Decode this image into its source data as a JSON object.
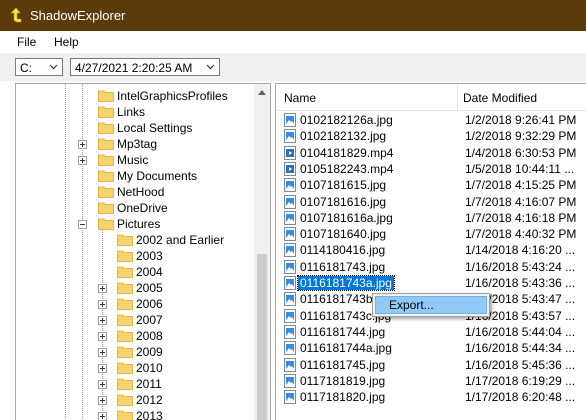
{
  "window": {
    "title": "ShadowExplorer"
  },
  "menu": {
    "items": [
      "File",
      "Help"
    ]
  },
  "toolbar": {
    "drive": "C:",
    "snapshot": "4/27/2021 2:20:25 AM"
  },
  "tree": {
    "items": [
      {
        "label": "IntelGraphicsProfiles",
        "expander": false
      },
      {
        "label": "Links",
        "expander": false
      },
      {
        "label": "Local Settings",
        "expander": false
      },
      {
        "label": "Mp3tag",
        "expander": "plus"
      },
      {
        "label": "Music",
        "expander": "plus"
      },
      {
        "label": "My Documents",
        "expander": false
      },
      {
        "label": "NetHood",
        "expander": false
      },
      {
        "label": "OneDrive",
        "expander": false
      },
      {
        "label": "Pictures",
        "expander": "minus"
      },
      {
        "label": "2002 and Earlier",
        "expander": false,
        "child": true
      },
      {
        "label": "2003",
        "expander": false,
        "child": true
      },
      {
        "label": "2004",
        "expander": false,
        "child": true
      },
      {
        "label": "2005",
        "expander": "plus",
        "child": true
      },
      {
        "label": "2006",
        "expander": "plus",
        "child": true
      },
      {
        "label": "2007",
        "expander": "plus",
        "child": true
      },
      {
        "label": "2008",
        "expander": "plus",
        "child": true
      },
      {
        "label": "2009",
        "expander": "plus",
        "child": true
      },
      {
        "label": "2010",
        "expander": "plus",
        "child": true
      },
      {
        "label": "2011",
        "expander": "plus",
        "child": true
      },
      {
        "label": "2012",
        "expander": "plus",
        "child": true
      },
      {
        "label": "2013",
        "expander": "plus",
        "child": true
      }
    ]
  },
  "files": {
    "columns": [
      "Name",
      "Date Modified"
    ],
    "rows": [
      {
        "name": "0102182126a.jpg",
        "date": "1/2/2018 9:26:41 PM",
        "type": "jpg"
      },
      {
        "name": "0102182132.jpg",
        "date": "1/2/2018 9:32:29 PM",
        "type": "jpg"
      },
      {
        "name": "0104181829.mp4",
        "date": "1/4/2018 6:30:53 PM",
        "type": "mp4"
      },
      {
        "name": "0105182243.mp4",
        "date": "1/5/2018 10:44:11 ...",
        "type": "mp4"
      },
      {
        "name": "0107181615.jpg",
        "date": "1/7/2018 4:15:25 PM",
        "type": "jpg"
      },
      {
        "name": "0107181616.jpg",
        "date": "1/7/2018 4:16:07 PM",
        "type": "jpg"
      },
      {
        "name": "0107181616a.jpg",
        "date": "1/7/2018 4:16:18 PM",
        "type": "jpg"
      },
      {
        "name": "0107181640.jpg",
        "date": "1/7/2018 4:40:32 PM",
        "type": "jpg"
      },
      {
        "name": "0114180416.jpg",
        "date": "1/14/2018 4:16:20 ...",
        "type": "jpg"
      },
      {
        "name": "0116181743.jpg",
        "date": "1/16/2018 5:43:24 ...",
        "type": "jpg"
      },
      {
        "name": "0116181743a.jpg",
        "date": "1/16/2018 5:43:36 ...",
        "type": "jpg",
        "selected": true
      },
      {
        "name": "0116181743b.jpg",
        "date": "1/16/2018 5:43:47 ...",
        "type": "jpg"
      },
      {
        "name": "0116181743c.jpg",
        "date": "1/16/2018 5:43:57 ...",
        "type": "jpg"
      },
      {
        "name": "0116181744.jpg",
        "date": "1/16/2018 5:44:04 ...",
        "type": "jpg"
      },
      {
        "name": "0116181744a.jpg",
        "date": "1/16/2018 5:44:34 ...",
        "type": "jpg"
      },
      {
        "name": "0116181745.jpg",
        "date": "1/16/2018 5:45:36 ...",
        "type": "jpg"
      },
      {
        "name": "0117181819.jpg",
        "date": "1/17/2018 6:19:29 ...",
        "type": "jpg"
      },
      {
        "name": "0117181820.jpg",
        "date": "1/17/2018 6:20:48 ...",
        "type": "jpg"
      }
    ]
  },
  "context_menu": {
    "items": [
      "Export..."
    ]
  },
  "colors": {
    "titlebar": "#5b3b0c",
    "folder": "#f7d36b",
    "selection": "#0078d7",
    "menu_highlight": "#91c9f7"
  }
}
